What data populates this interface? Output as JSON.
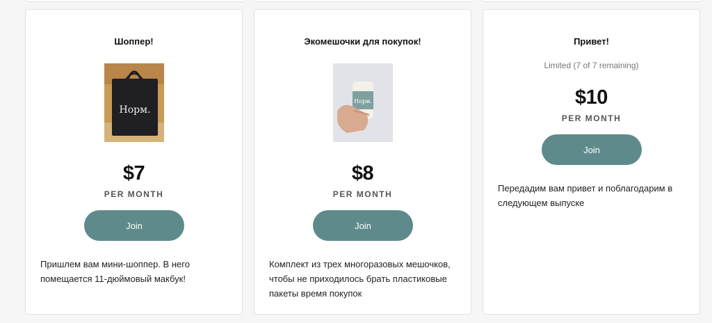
{
  "tiers": [
    {
      "title": "Шоппер!",
      "image_text": "Норм.",
      "price": "$7",
      "per": "PER MONTH",
      "join_label": "Join",
      "description": "Пришлем вам мини-шоппер. В него помещается 11-дюймовый макбук!"
    },
    {
      "title": "Экомешочки для покупок!",
      "image_text": "Норм.",
      "price": "$8",
      "per": "PER MONTH",
      "join_label": "Join",
      "description": "Комплект из трех многоразовых мешочков, чтобы не приходилось брать пластиковые пакеты время покупок"
    },
    {
      "title": "Привет!",
      "limit": "Limited (7 of 7 remaining)",
      "price": "$10",
      "per": "PER MONTH",
      "join_label": "Join",
      "description": "Передадим вам привет и поблагодарим в следующем выпуске"
    }
  ],
  "colors": {
    "button": "#5f8a8b",
    "card_bg": "#ffffff",
    "page_bg": "#f6f6f6"
  }
}
